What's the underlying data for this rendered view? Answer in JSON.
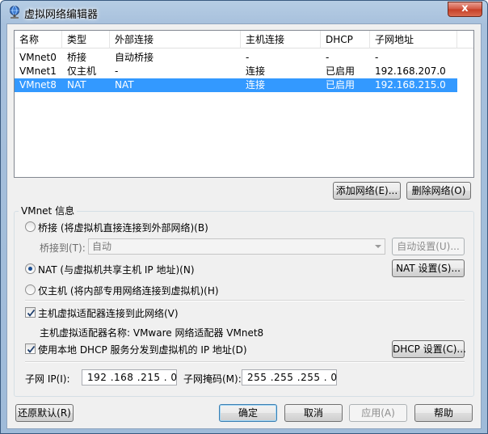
{
  "window": {
    "title": "虚拟网络编辑器",
    "close_label": "x"
  },
  "table": {
    "columns": [
      "名称",
      "类型",
      "外部连接",
      "主机连接",
      "DHCP",
      "子网地址"
    ],
    "rows": [
      {
        "name": "VMnet0",
        "type": "桥接",
        "external": "自动桥接",
        "host": "-",
        "dhcp": "-",
        "subnet": "-"
      },
      {
        "name": "VMnet1",
        "type": "仅主机",
        "external": "-",
        "host": "连接",
        "dhcp": "已启用",
        "subnet": "192.168.207.0"
      },
      {
        "name": "VMnet8",
        "type": "NAT",
        "external": "NAT",
        "host": "连接",
        "dhcp": "已启用",
        "subnet": "192.168.215.0"
      }
    ],
    "selected_index": 2
  },
  "buttons": {
    "add_network": "添加网络(E)...",
    "remove_network": "删除网络(O)",
    "auto_settings": "自动设置(U)...",
    "nat_settings": "NAT 设置(S)...",
    "dhcp_settings": "DHCP 设置(C)...",
    "restore_defaults": "还原默认(R)",
    "ok": "确定",
    "cancel": "取消",
    "apply": "应用(A)",
    "help": "帮助"
  },
  "vmnet_info": {
    "group_title": "VMnet 信息",
    "bridged_label": "桥接 (将虚拟机直接连接到外部网络)(B)",
    "bridged_to_label": "桥接到(T):",
    "bridged_to_value": "自动",
    "nat_label": "NAT (与虚拟机共享主机 IP 地址)(N)",
    "host_only_label": "仅主机 (将内部专用网络连接到虚拟机)(H)",
    "selected_mode": "nat",
    "connect_adapter_label": "主机虚拟适配器连接到此网络(V)",
    "connect_adapter_checked": true,
    "adapter_name_label": "主机虚拟适配器名称: VMware 网络适配器 VMnet8",
    "use_dhcp_label": "使用本地 DHCP 服务分发到虚拟机的 IP 地址(D)",
    "use_dhcp_checked": true,
    "subnet_ip_label": "子网 IP(I):",
    "subnet_ip_value": "192 .168 .215 . 0",
    "subnet_mask_label": "子网掩码(M):",
    "subnet_mask_value": "255 .255 .255 . 0"
  },
  "colors": {
    "selection": "#3399ff",
    "titlebar": "#a7c0dc",
    "close_button": "#c53e26"
  }
}
